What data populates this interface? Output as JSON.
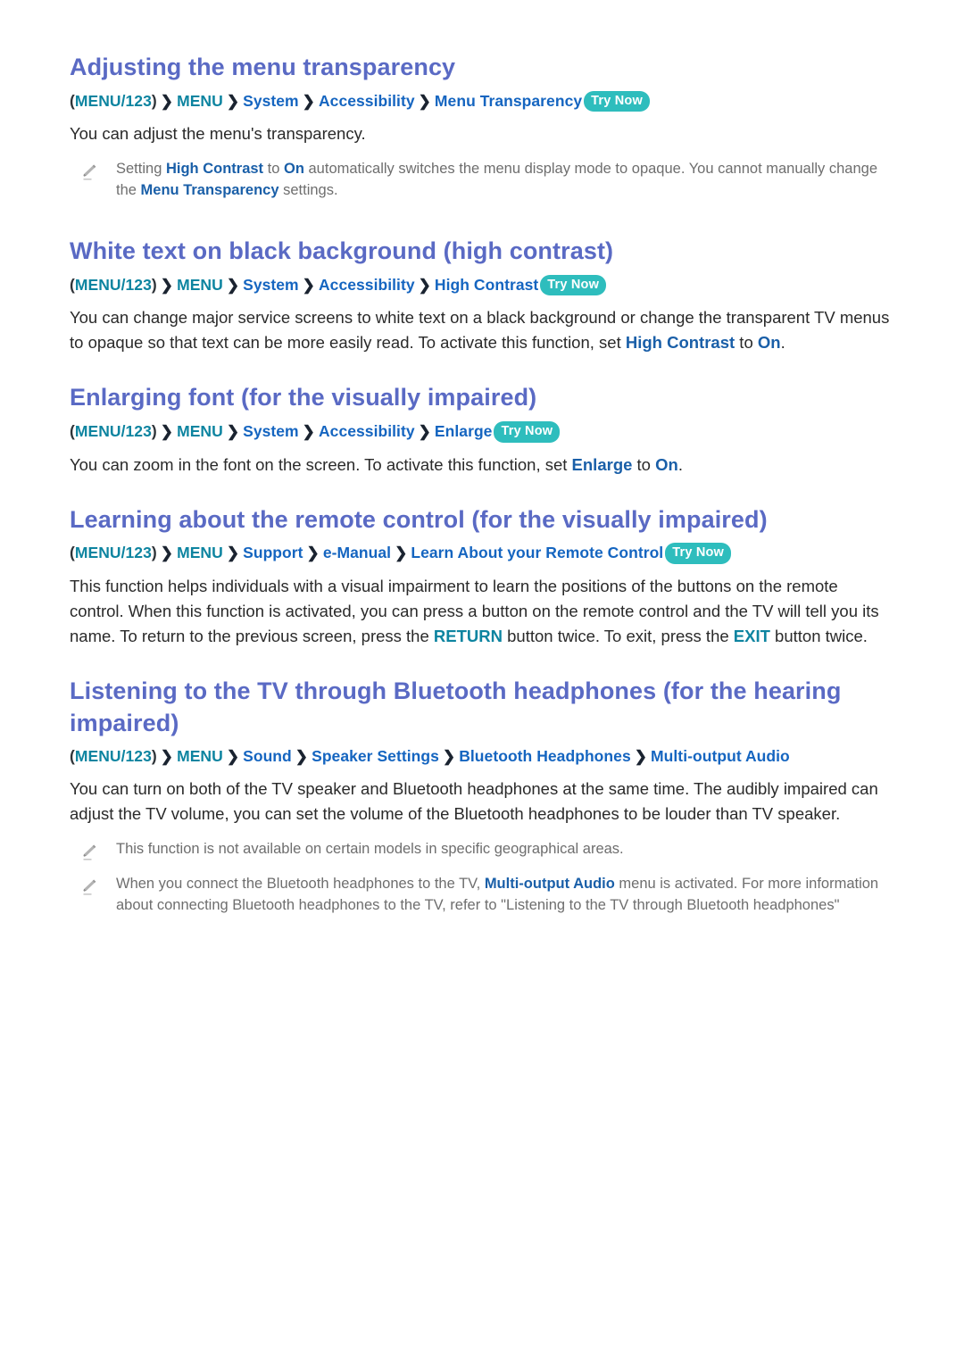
{
  "colors": {
    "heading": "#5a6ac4",
    "breadcrumb_teal": "#0d84a0",
    "breadcrumb_blue": "#1565c0",
    "try_now_badge": "#2ebdbd",
    "body_text": "#2a2a2a",
    "note_text": "#6e6e6e",
    "highlight_blue": "#1a5fa8",
    "page_background": "#ffffff"
  },
  "labels": {
    "try_now": "Try Now",
    "separator": "❯",
    "menu_123": "MENU/123",
    "paren_open": "(",
    "paren_close": ")",
    "note_icon": "pencil-icon"
  },
  "sections": [
    {
      "heading": "Adjusting the menu transparency",
      "breadcrumb": [
        {
          "text": "MENU/123",
          "color": "teal",
          "parens": true
        },
        {
          "text": "MENU",
          "color": "teal"
        },
        {
          "text": "System",
          "color": "blue"
        },
        {
          "text": "Accessibility",
          "color": "blue"
        },
        {
          "text": "Menu Transparency",
          "color": "blue"
        }
      ],
      "try_now": true,
      "body": [
        {
          "t": "You can adjust the menu's transparency."
        }
      ],
      "notes": [
        [
          {
            "t": "Setting "
          },
          {
            "t": "High Contrast",
            "hl": true
          },
          {
            "t": " to "
          },
          {
            "t": "On",
            "hl": true
          },
          {
            "t": " automatically switches the menu display mode to opaque. You cannot manually change the "
          },
          {
            "t": "Menu Transparency",
            "hl": true
          },
          {
            "t": " settings."
          }
        ]
      ]
    },
    {
      "heading": "White text on black background (high contrast)",
      "breadcrumb": [
        {
          "text": "MENU/123",
          "color": "teal",
          "parens": true
        },
        {
          "text": "MENU",
          "color": "teal"
        },
        {
          "text": "System",
          "color": "blue"
        },
        {
          "text": "Accessibility",
          "color": "blue"
        },
        {
          "text": "High Contrast",
          "color": "blue"
        }
      ],
      "try_now": true,
      "body": [
        {
          "t": "You can change major service screens to white text on a black background or change the transparent TV menus to opaque so that text can be more easily read. To activate this function, set "
        },
        {
          "t": "High Contrast",
          "hl": true
        },
        {
          "t": " to "
        },
        {
          "t": "On",
          "hl": true
        },
        {
          "t": "."
        }
      ],
      "notes": []
    },
    {
      "heading": "Enlarging font (for the visually impaired)",
      "breadcrumb": [
        {
          "text": "MENU/123",
          "color": "teal",
          "parens": true
        },
        {
          "text": "MENU",
          "color": "teal"
        },
        {
          "text": "System",
          "color": "blue"
        },
        {
          "text": "Accessibility",
          "color": "blue"
        },
        {
          "text": "Enlarge",
          "color": "blue"
        }
      ],
      "try_now": true,
      "body": [
        {
          "t": "You can zoom in the font on the screen. To activate this function, set "
        },
        {
          "t": "Enlarge",
          "hl": true
        },
        {
          "t": " to "
        },
        {
          "t": "On",
          "hl": true
        },
        {
          "t": "."
        }
      ],
      "notes": []
    },
    {
      "heading": "Learning about the remote control (for the visually impaired)",
      "breadcrumb": [
        {
          "text": "MENU/123",
          "color": "teal",
          "parens": true
        },
        {
          "text": "MENU",
          "color": "teal"
        },
        {
          "text": "Support",
          "color": "blue"
        },
        {
          "text": "e-Manual",
          "color": "blue"
        },
        {
          "text": "Learn About your Remote Control",
          "color": "blue"
        }
      ],
      "try_now": true,
      "body": [
        {
          "t": "This function helps individuals with a visual impairment to learn the positions of the buttons on the remote control. When this function is activated, you can press a button on the remote control and the TV will tell you its name. To return to the previous screen, press the "
        },
        {
          "t": "RETURN",
          "hl_teal": true
        },
        {
          "t": " button twice. To exit, press the "
        },
        {
          "t": "EXIT",
          "hl_teal": true
        },
        {
          "t": " button twice."
        }
      ],
      "notes": []
    },
    {
      "heading": "Listening to the TV through Bluetooth headphones (for the hearing impaired)",
      "breadcrumb": [
        {
          "text": "MENU/123",
          "color": "teal",
          "parens": true
        },
        {
          "text": "MENU",
          "color": "teal"
        },
        {
          "text": "Sound",
          "color": "blue"
        },
        {
          "text": "Speaker Settings",
          "color": "blue"
        },
        {
          "text": "Bluetooth Headphones",
          "color": "blue"
        },
        {
          "text": "Multi-output Audio",
          "color": "blue"
        }
      ],
      "try_now": false,
      "body": [
        {
          "t": "You can turn on both of the TV speaker and Bluetooth headphones at the same time. The audibly impaired can adjust the TV volume, you can set the volume of the Bluetooth headphones to be louder than TV speaker."
        }
      ],
      "notes": [
        [
          {
            "t": "This function is not available on certain models in specific geographical areas."
          }
        ],
        [
          {
            "t": "When you connect the Bluetooth headphones to the TV, "
          },
          {
            "t": "Multi-output Audio",
            "hl": true
          },
          {
            "t": " menu is activated. For more information about connecting Bluetooth headphones to the TV, refer to \"Listening to the TV through Bluetooth headphones\""
          }
        ]
      ]
    }
  ]
}
